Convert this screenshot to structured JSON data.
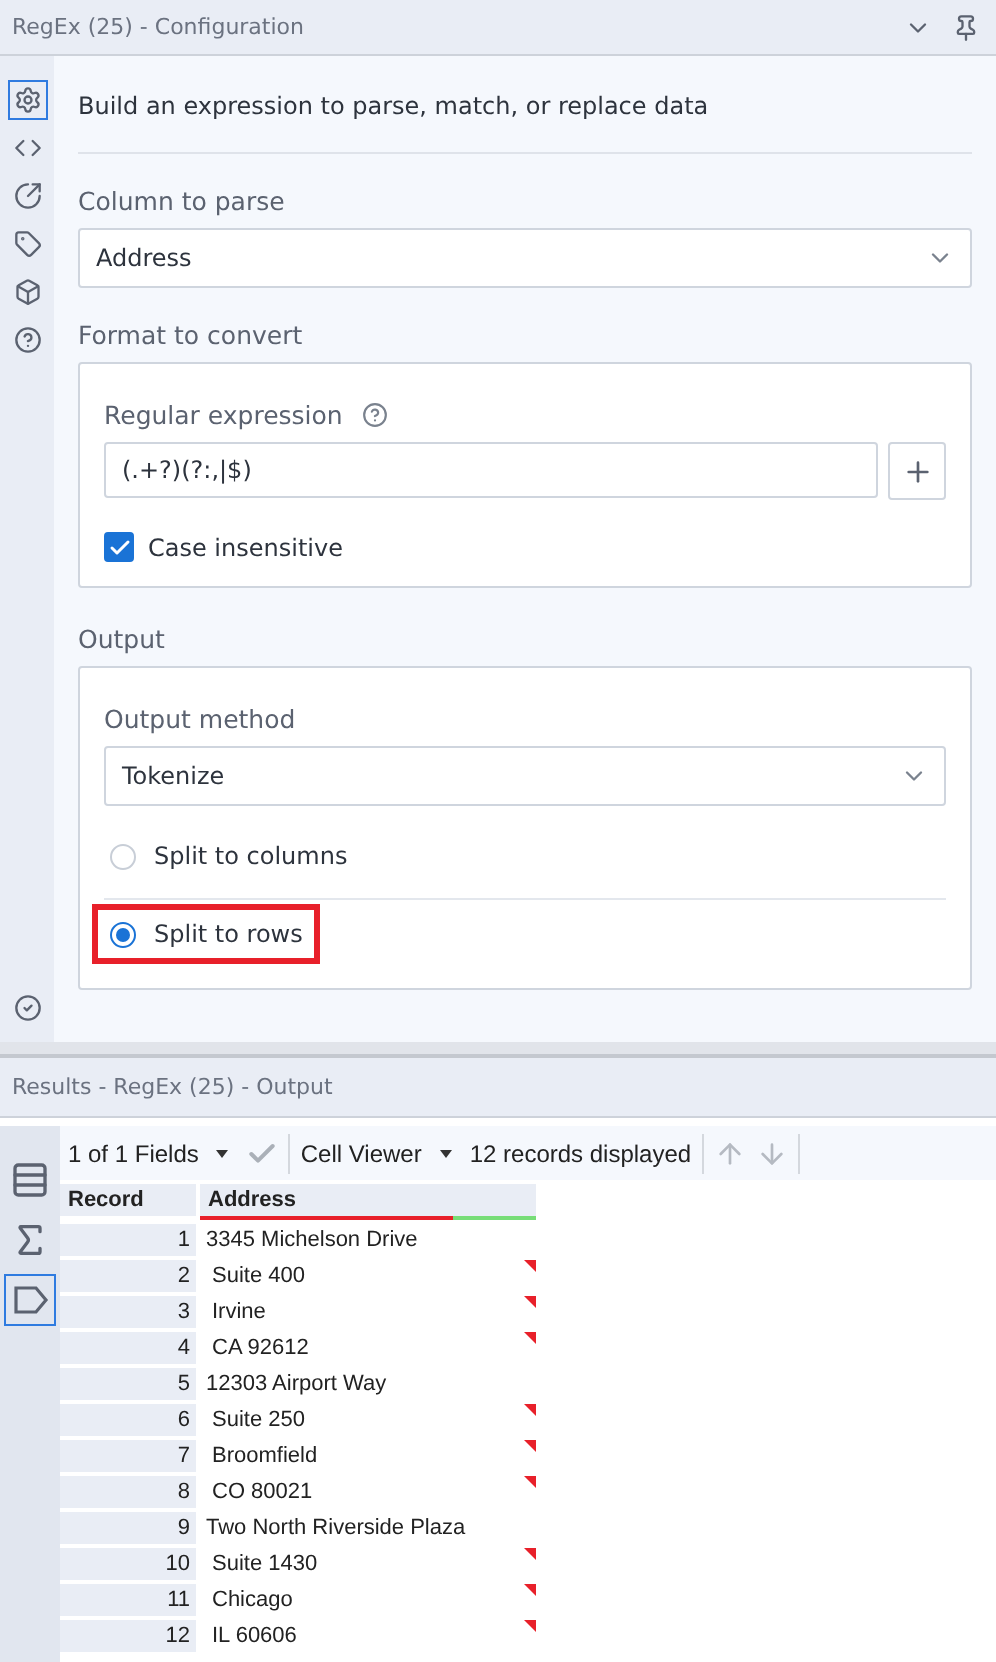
{
  "config_panel": {
    "title": "RegEx (25) - Configuration",
    "description": "Build an expression to parse, match, or replace data",
    "side_icons": [
      {
        "kind": "gear",
        "selected": true
      },
      {
        "kind": "code",
        "selected": false
      },
      {
        "kind": "arrow",
        "selected": false
      },
      {
        "kind": "tag",
        "selected": false
      },
      {
        "kind": "cube",
        "selected": false
      },
      {
        "kind": "help",
        "selected": false
      }
    ],
    "column_to_parse": {
      "label": "Column to parse",
      "value": "Address"
    },
    "format_section": {
      "heading": "Format to convert",
      "regex_label": "Regular expression",
      "regex_value": "(.+?)(?:,|$)",
      "case_insensitive": {
        "label": "Case insensitive",
        "checked": true
      }
    },
    "output_section": {
      "heading": "Output",
      "method_label": "Output method",
      "method_value": "Tokenize",
      "options": [
        {
          "label": "Split to columns",
          "selected": false,
          "highlighted": false
        },
        {
          "label": "Split to rows",
          "selected": true,
          "highlighted": true
        }
      ]
    }
  },
  "results_panel": {
    "title": "Results - RegEx (25) - Output",
    "toolbar": {
      "fields": "1 of 1 Fields",
      "viewer": "Cell Viewer",
      "records": "12 records displayed"
    },
    "side_icons": [
      {
        "kind": "list",
        "selected": false
      },
      {
        "kind": "sigma",
        "selected": false
      },
      {
        "kind": "tag",
        "selected": true
      }
    ],
    "columns": [
      "Record",
      "Address"
    ],
    "rows": [
      {
        "record": "1",
        "address": "3345 Michelson Drive",
        "flagged": false
      },
      {
        "record": "2",
        "address": "Suite 400",
        "flagged": true
      },
      {
        "record": "3",
        "address": "Irvine",
        "flagged": true
      },
      {
        "record": "4",
        "address": "CA 92612",
        "flagged": true
      },
      {
        "record": "5",
        "address": "12303 Airport Way",
        "flagged": false
      },
      {
        "record": "6",
        "address": "Suite 250",
        "flagged": true
      },
      {
        "record": "7",
        "address": "Broomfield",
        "flagged": true
      },
      {
        "record": "8",
        "address": "CO 80021",
        "flagged": true
      },
      {
        "record": "9",
        "address": "Two North Riverside Plaza",
        "flagged": false
      },
      {
        "record": "10",
        "address": "Suite 1430",
        "flagged": true
      },
      {
        "record": "11",
        "address": "Chicago",
        "flagged": true
      },
      {
        "record": "12",
        "address": "IL 60606",
        "flagged": true
      }
    ]
  }
}
